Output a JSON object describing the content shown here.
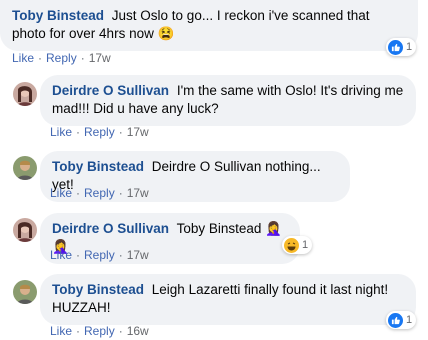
{
  "comments": [
    {
      "author": "Toby Binstead",
      "text": "Just Oslo to go... I reckon i've scanned that photo for over 4hrs now",
      "emoji": "😫",
      "like": "Like",
      "reply": "Reply",
      "time": "17w",
      "reaction_count": "1"
    },
    {
      "author": "Deirdre O Sullivan",
      "text": "I'm the same with Oslo! It's driving me mad!!! Did u have any luck?",
      "like": "Like",
      "reply": "Reply",
      "time": "17w"
    },
    {
      "author": "Toby Binstead",
      "text": "Deirdre O Sullivan nothing... yet!",
      "like": "Like",
      "reply": "Reply",
      "time": "17w"
    },
    {
      "author": "Deirdre O Sullivan",
      "text": "Toby Binstead",
      "emoji": "🤦‍♀️🤦‍♀️",
      "like": "Like",
      "reply": "Reply",
      "time": "17w",
      "reaction_count": "1"
    },
    {
      "author": "Toby Binstead",
      "text": "Leigh Lazaretti finally found it last night! HUZZAH!",
      "like": "Like",
      "reply": "Reply",
      "time": "16w",
      "reaction_count": "1"
    }
  ],
  "separator": "·",
  "colors": {
    "link": "#385898",
    "bubble": "#f0f2f5",
    "like_blue": "#1877f2",
    "haha_yellow": "#f7b928"
  },
  "icons": {
    "like_reaction": "thumbs-up-icon",
    "haha_reaction": "laughing-face-icon"
  }
}
